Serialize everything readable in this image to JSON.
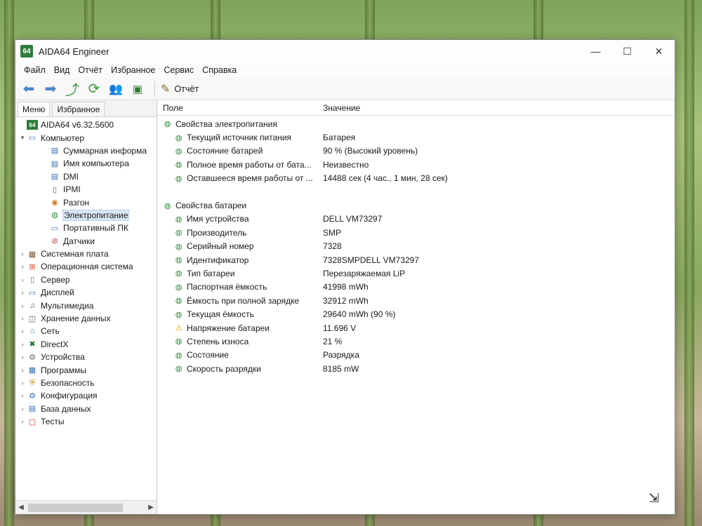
{
  "window": {
    "title": "AIDA64 Engineer",
    "icon_text": "64"
  },
  "window_controls": {
    "minimize": "—",
    "maximize": "☐",
    "close": "✕"
  },
  "menu": [
    "Файл",
    "Вид",
    "Отчёт",
    "Избранное",
    "Сервис",
    "Справка"
  ],
  "toolbar": {
    "report_label": "Отчёт"
  },
  "left_panel": {
    "tabs": [
      "Меню",
      "Избранное"
    ],
    "tree": [
      {
        "label": "AIDA64 v6.32.5600",
        "level": 0,
        "expander": "",
        "icon": "aida-icon"
      },
      {
        "label": "Компьютер",
        "level": 0,
        "expander": "▾",
        "icon": "computer-icon"
      },
      {
        "label": "Суммарная информа",
        "level": 1,
        "expander": "",
        "icon": "summary-icon"
      },
      {
        "label": "Имя компьютера",
        "level": 1,
        "expander": "",
        "icon": "computer-name-icon"
      },
      {
        "label": "DMI",
        "level": 1,
        "expander": "",
        "icon": "dmi-icon"
      },
      {
        "label": "IPMI",
        "level": 1,
        "expander": "",
        "icon": "ipmi-icon"
      },
      {
        "label": "Разгон",
        "level": 1,
        "expander": "",
        "icon": "overclock-icon"
      },
      {
        "label": "Электропитание",
        "level": 1,
        "expander": "",
        "icon": "power-icon",
        "selected": true
      },
      {
        "label": "Портативный ПК",
        "level": 1,
        "expander": "",
        "icon": "laptop-icon"
      },
      {
        "label": "Датчики",
        "level": 1,
        "expander": "",
        "icon": "sensors-icon"
      },
      {
        "label": "Системная плата",
        "level": 0,
        "expander": "›",
        "icon": "motherboard-icon"
      },
      {
        "label": "Операционная система",
        "level": 0,
        "expander": "›",
        "icon": "os-icon"
      },
      {
        "label": "Сервер",
        "level": 0,
        "expander": "›",
        "icon": "server-icon"
      },
      {
        "label": "Дисплей",
        "level": 0,
        "expander": "›",
        "icon": "display-icon"
      },
      {
        "label": "Мультимедиа",
        "level": 0,
        "expander": "›",
        "icon": "multimedia-icon"
      },
      {
        "label": "Хранение данных",
        "level": 0,
        "expander": "›",
        "icon": "storage-icon"
      },
      {
        "label": "Сеть",
        "level": 0,
        "expander": "›",
        "icon": "network-icon"
      },
      {
        "label": "DirectX",
        "level": 0,
        "expander": "›",
        "icon": "directx-icon"
      },
      {
        "label": "Устройства",
        "level": 0,
        "expander": "›",
        "icon": "devices-icon"
      },
      {
        "label": "Программы",
        "level": 0,
        "expander": "›",
        "icon": "programs-icon"
      },
      {
        "label": "Безопасность",
        "level": 0,
        "expander": "›",
        "icon": "security-icon"
      },
      {
        "label": "Конфигурация",
        "level": 0,
        "expander": "›",
        "icon": "config-icon"
      },
      {
        "label": "База данных",
        "level": 0,
        "expander": "›",
        "icon": "database-icon"
      },
      {
        "label": "Тесты",
        "level": 0,
        "expander": "›",
        "icon": "tests-icon"
      }
    ]
  },
  "table": {
    "headers": {
      "field": "Поле",
      "value": "Значение"
    },
    "rows": [
      {
        "type": "group",
        "field": "Свойства электропитания",
        "value": ""
      },
      {
        "type": "item",
        "field": "Текущий источник питания",
        "value": "Батарея"
      },
      {
        "type": "item",
        "field": "Состояние батарей",
        "value": "90 % (Высокий уровень)"
      },
      {
        "type": "item",
        "field": "Полное время работы от бата...",
        "value": "Неизвестно"
      },
      {
        "type": "item",
        "field": "Оставшееся время работы от ...",
        "value": "14488 сек (4 час., 1 мин, 28 сек)"
      },
      {
        "type": "spacer"
      },
      {
        "type": "group",
        "field": "Свойства батареи",
        "value": ""
      },
      {
        "type": "item",
        "field": "Имя устройства",
        "value": "DELL VM73297"
      },
      {
        "type": "item",
        "field": "Производитель",
        "value": "SMP"
      },
      {
        "type": "item",
        "field": "Серийный номер",
        "value": "7328"
      },
      {
        "type": "item",
        "field": "Идентификатор",
        "value": "7328SMPDELL VM73297"
      },
      {
        "type": "item",
        "field": "Тип батареи",
        "value": "Перезаряжаемая LiP"
      },
      {
        "type": "item",
        "field": "Паспортная ёмкость",
        "value": "41998 mWh"
      },
      {
        "type": "item",
        "field": "Ёмкость при полной зарядке",
        "value": "32912 mWh"
      },
      {
        "type": "item",
        "field": "Текущая ёмкость",
        "value": "29640 mWh  (90 %)"
      },
      {
        "type": "item",
        "field": "Напряжение батареи",
        "value": "11.696 V",
        "warn": true
      },
      {
        "type": "item",
        "field": "Степень износа",
        "value": "21 %"
      },
      {
        "type": "item",
        "field": "Состояние",
        "value": "Разрядка"
      },
      {
        "type": "item",
        "field": "Скорость разрядки",
        "value": "8185 mW"
      }
    ]
  }
}
